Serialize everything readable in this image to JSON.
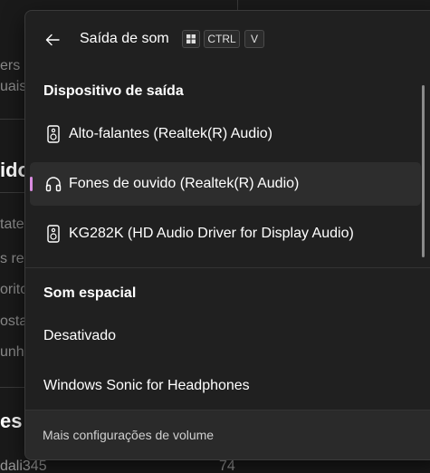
{
  "background": {
    "fragments": [
      "ers",
      "uais",
      "ido",
      "tate",
      "s rec",
      "orito",
      "osta",
      "unh",
      "es s",
      "dali345",
      "74"
    ]
  },
  "header": {
    "back_icon": "arrow-left-icon",
    "title": "Saída de som",
    "shortcut": {
      "win_icon": "windows-key-icon",
      "ctrl": "CTRL",
      "key": "V"
    }
  },
  "output_section": {
    "title": "Dispositivo de saída",
    "items": [
      {
        "label": "Alto-falantes (Realtek(R) Audio)",
        "icon": "speaker-icon",
        "selected": false
      },
      {
        "label": "Fones de ouvido (Realtek(R) Audio)",
        "icon": "headphones-icon",
        "selected": true
      },
      {
        "label": "KG282K (HD Audio Driver for Display Audio)",
        "icon": "speaker-icon",
        "selected": false
      }
    ]
  },
  "spatial_section": {
    "title": "Som espacial",
    "items": [
      {
        "label": "Desativado"
      },
      {
        "label": "Windows Sonic for Headphones"
      }
    ]
  },
  "footer": {
    "link": "Mais configurações de volume"
  },
  "colors": {
    "accent": "#d98ce0",
    "flyout_bg": "#202020",
    "selected_bg": "#2d2d2d"
  }
}
